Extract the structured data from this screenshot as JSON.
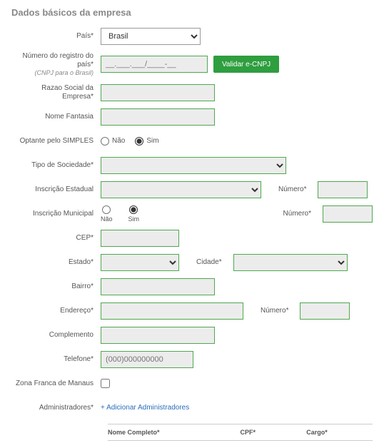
{
  "section": {
    "title": "Dados básicos da empresa"
  },
  "labels": {
    "pais": "País*",
    "numero_registro": "Número do registro do país*",
    "numero_registro_sub": "(CNPJ para o Brasil)",
    "razao_social": "Razao Social da Empresa*",
    "nome_fantasia": "Nome Fantasia",
    "optante_simples": "Optante pelo SIMPLES",
    "tipo_sociedade": "Tipo de Sociedade*",
    "inscricao_estadual": "Inscrição Estadual",
    "inscricao_municipal": "Inscrição Municipal",
    "cep": "CEP*",
    "estado": "Estado*",
    "cidade": "Cidade*",
    "bairro": "Bairro*",
    "endereco": "Endereço*",
    "numero": "Número*",
    "complemento": "Complemento",
    "telefone": "Telefone*",
    "zona_franca": "Zona Franca de Manaus",
    "administradores": "Administradores*"
  },
  "values": {
    "pais_selected": "Brasil",
    "registro_placeholder": "__.___.___/____-__",
    "telefone_placeholder": "(000)000000000"
  },
  "buttons": {
    "validar_cnpj": "Validar e-CNPJ"
  },
  "radios": {
    "nao": "Não",
    "sim": "Sim"
  },
  "links": {
    "add_admin": "+ Adicionar Administradores"
  },
  "table": {
    "col_nome": "Nome Completo*",
    "col_cpf": "CPF*",
    "col_cargo": "Cargo*"
  }
}
